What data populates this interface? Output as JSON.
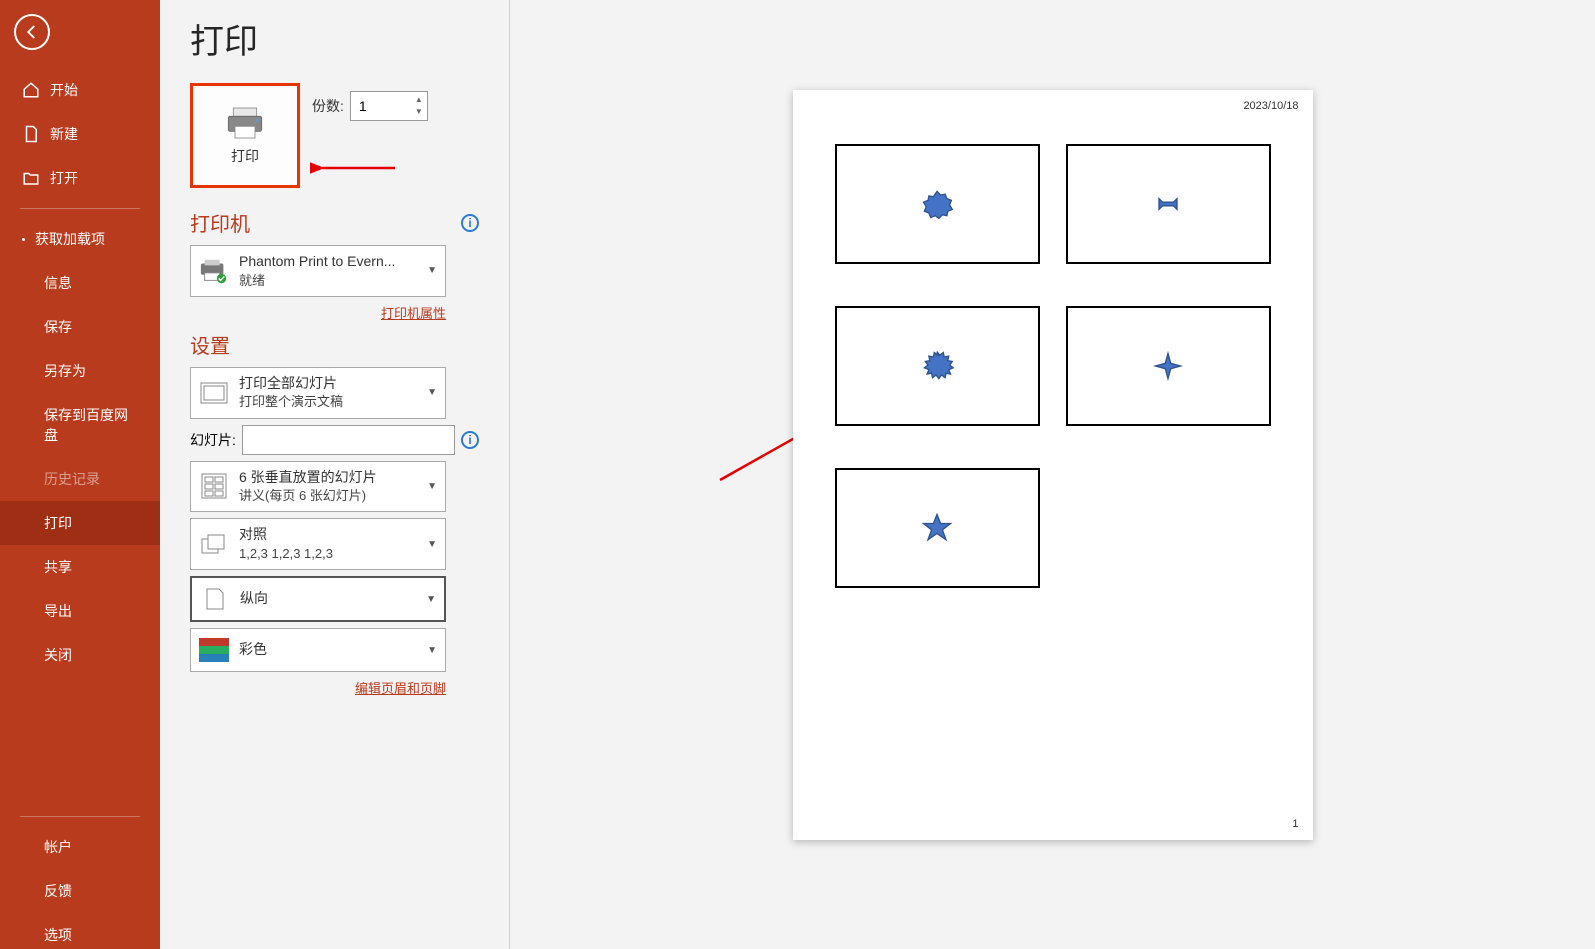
{
  "nav": {
    "home": "开始",
    "new": "新建",
    "open": "打开",
    "addins": "获取加载项",
    "info": "信息",
    "save": "保存",
    "saveas": "另存为",
    "baidu": "保存到百度网盘",
    "history": "历史记录",
    "print": "打印",
    "share": "共享",
    "export": "导出",
    "close": "关闭",
    "account": "帐户",
    "feedback": "反馈",
    "options": "选项"
  },
  "title": "打印",
  "printBtn": "打印",
  "copies": {
    "label": "份数:",
    "value": "1"
  },
  "printer": {
    "section": "打印机",
    "name": "Phantom Print to Evern...",
    "status": "就绪",
    "propsLink": "打印机属性"
  },
  "settings": {
    "section": "设置",
    "range": {
      "line1": "打印全部幻灯片",
      "line2": "打印整个演示文稿"
    },
    "slidesLabel": "幻灯片:",
    "layout": {
      "line1": "6 张垂直放置的幻灯片",
      "line2": "讲义(每页 6 张幻灯片)"
    },
    "collate": {
      "line1": "对照",
      "line2": "1,2,3   1,2,3   1,2,3"
    },
    "orientation": "纵向",
    "color": "彩色",
    "headerLink": "编辑页眉和页脚"
  },
  "preview": {
    "date": "2023/10/18",
    "page": "1"
  }
}
